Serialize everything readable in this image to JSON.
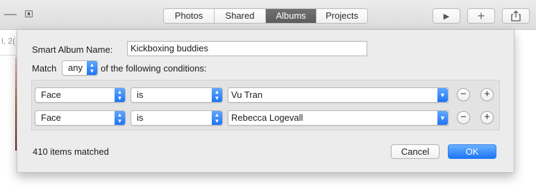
{
  "toolbar": {
    "tabs": [
      {
        "label": "Photos",
        "active": false
      },
      {
        "label": "Shared",
        "active": false
      },
      {
        "label": "Albums",
        "active": true
      },
      {
        "label": "Projects",
        "active": false
      }
    ],
    "buttons": [
      {
        "icon": "play-icon",
        "glyph": "▶"
      },
      {
        "icon": "add-icon",
        "glyph": "+"
      },
      {
        "icon": "share-icon",
        "glyph": "⇪"
      }
    ]
  },
  "background": {
    "partial_date_text": "l, 2("
  },
  "dialog": {
    "name_label": "Smart Album Name:",
    "name_value": "Kickboxing buddies",
    "match_prefix": "Match",
    "match_value": "any",
    "match_suffix": "of the following conditions:",
    "conditions": [
      {
        "field": "Face",
        "operator": "is",
        "value": "Vu Tran"
      },
      {
        "field": "Face",
        "operator": "is",
        "value": "Rebecca Logevall"
      }
    ],
    "remove_glyph": "−",
    "add_glyph": "+",
    "status": "410 items matched",
    "cancel_label": "Cancel",
    "ok_label": "OK"
  },
  "colors": {
    "accent": "#1e74f4",
    "sheet_background": "#ececec",
    "toolbar_active_segment": "#666666"
  }
}
